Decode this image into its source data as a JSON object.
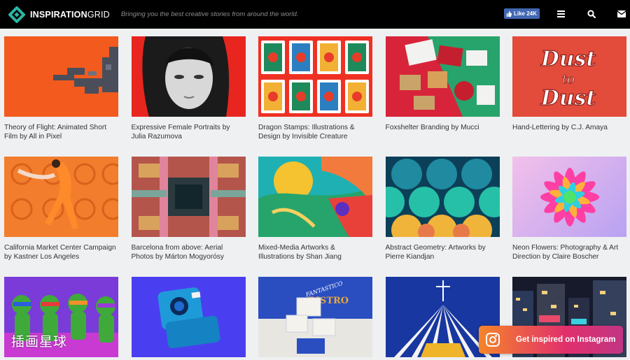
{
  "header": {
    "brand_bold": "INSPIRATION",
    "brand_thin": "GRID",
    "tagline": "Bringing you the best creative stories from around the world.",
    "fb_like_label": "Like 24K",
    "icons": [
      "menu-icon",
      "search-icon",
      "mail-icon"
    ]
  },
  "articles": [
    {
      "title": "Theory of Flight: Animated Short Film by All in Pixel"
    },
    {
      "title": "Expressive Female Portraits by Julia Razumova"
    },
    {
      "title": "Dragon Stamps: Illustrations & Design by Invisible Creature"
    },
    {
      "title": "Foxshelter Branding by Mucci"
    },
    {
      "title": "Hand-Lettering by C.J. Amaya"
    },
    {
      "title": "California Market Center Campaign by Kastner Los Angeles"
    },
    {
      "title": "Barcelona from above: Aerial Photos by Márton Mogyorósy"
    },
    {
      "title": "Mixed-Media Artworks & Illustrations by Shan Jiang"
    },
    {
      "title": "Abstract Geometry: Artworks by Pierre Kiandjan"
    },
    {
      "title": "Neon Flowers: Photography & Art Direction by Claire Boscher"
    },
    {
      "title": ""
    },
    {
      "title": ""
    },
    {
      "title": ""
    },
    {
      "title": ""
    },
    {
      "title": ""
    }
  ],
  "thumb_texts": {
    "dust": "Dust to Dust",
    "bistro_brand": "FANTASTICO",
    "bistro_name": "BISTRO"
  },
  "watermark": "插画星球",
  "instagram_cta": "Get inspired on Instagram",
  "colors": {
    "header_bg": "#000000",
    "page_bg": "#eef0f2",
    "logo_teal": "#2bb5a5",
    "fb_blue": "#4267b2"
  }
}
